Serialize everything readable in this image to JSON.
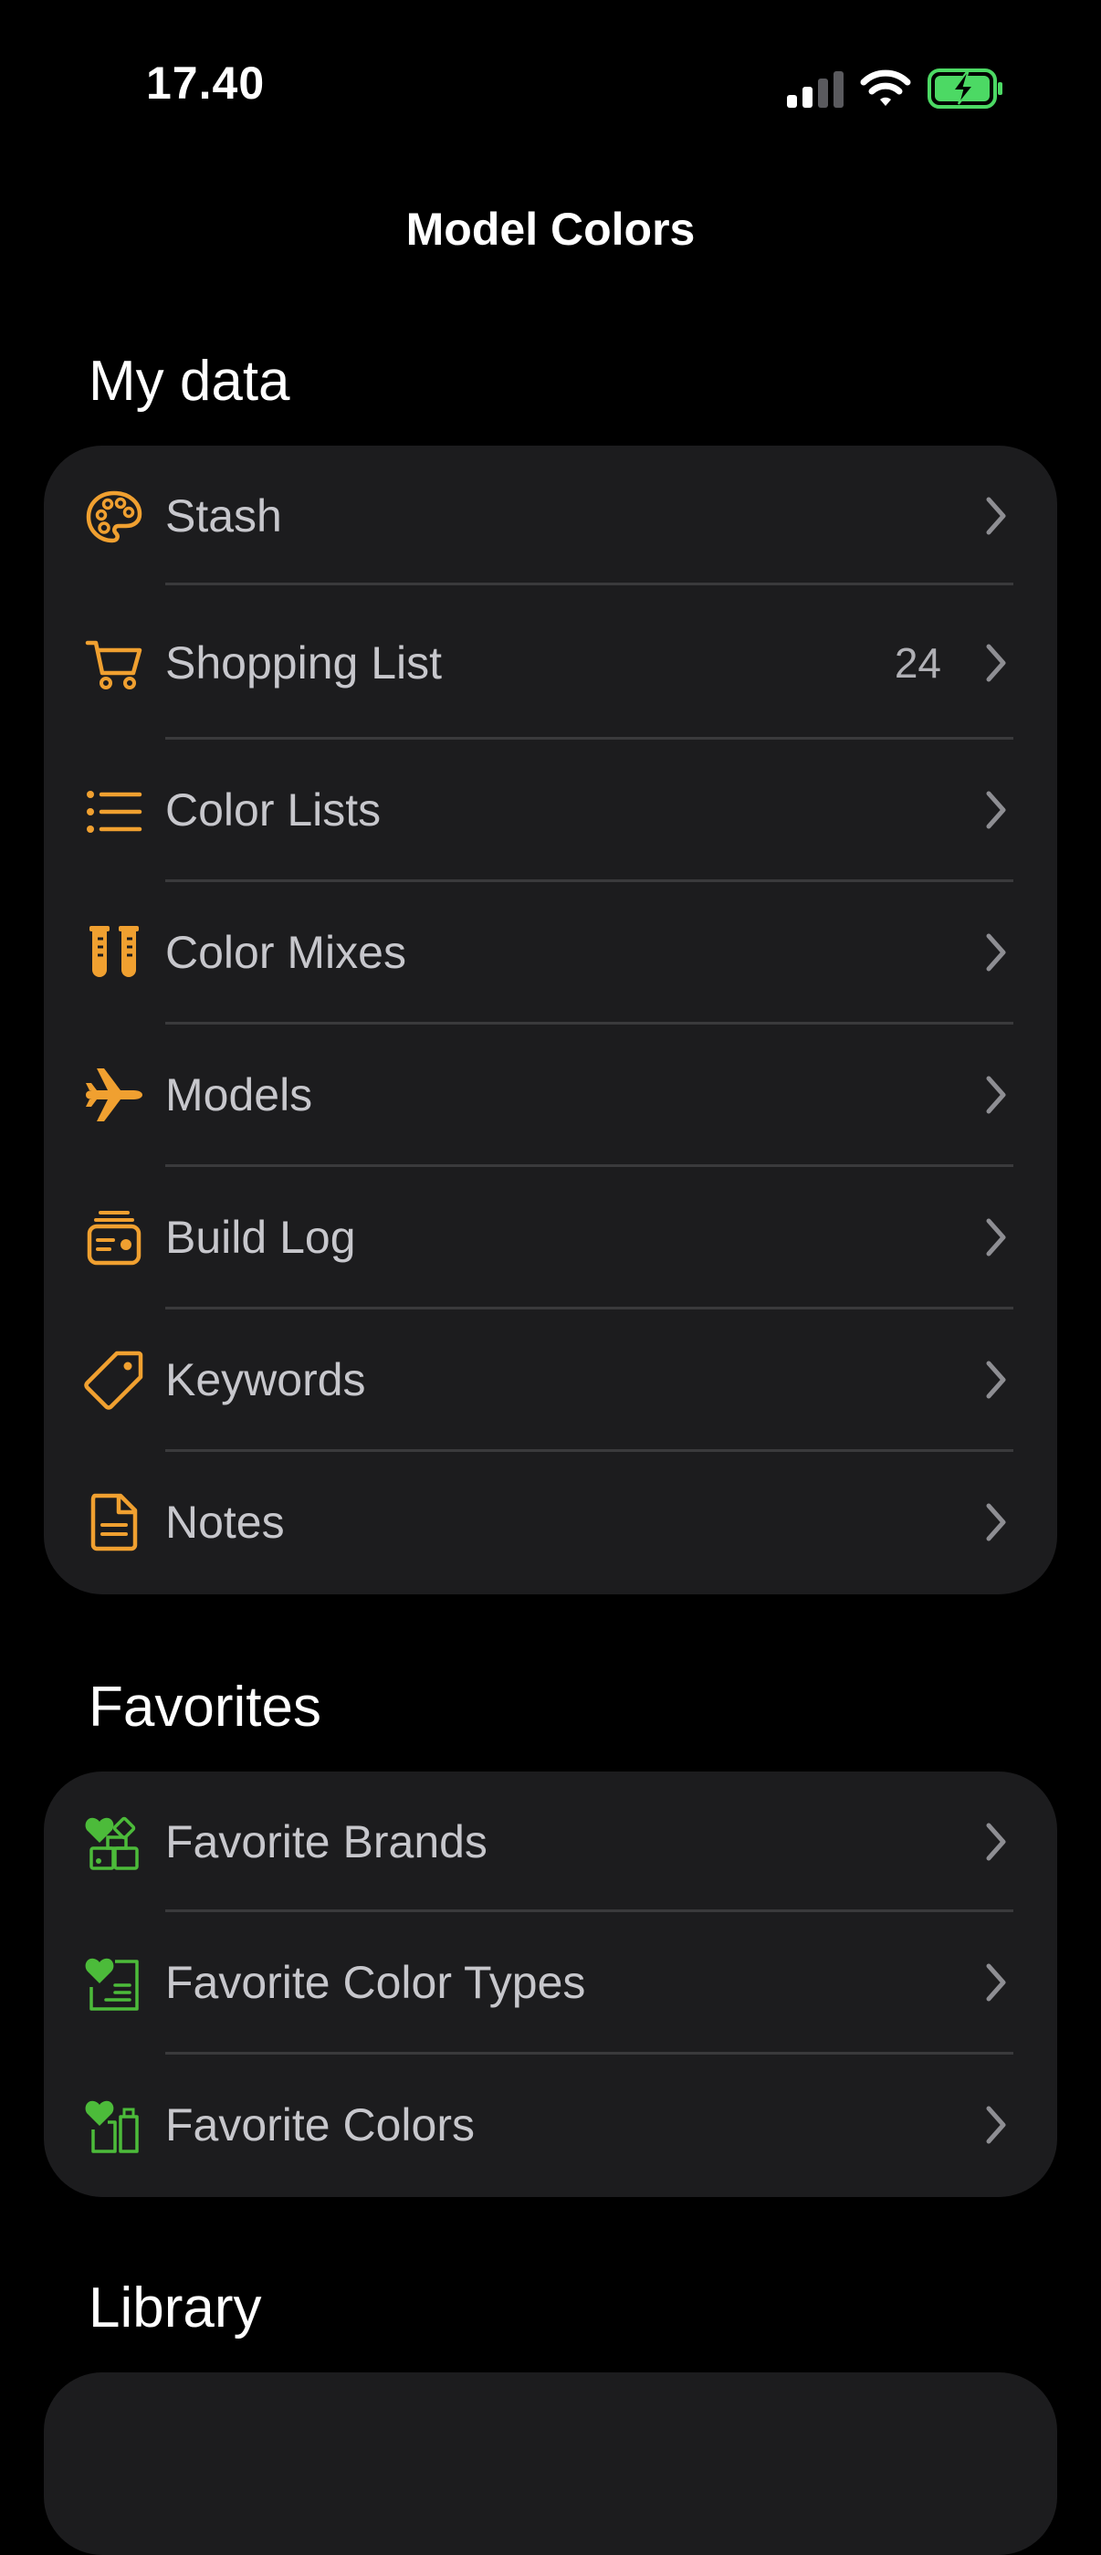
{
  "status_bar": {
    "time": "17.40",
    "signal_icon": "cellular-signal-icon",
    "wifi_icon": "wifi-icon",
    "battery_icon": "battery-charging-icon",
    "battery_color": "#4cd964"
  },
  "nav": {
    "title": "Model Colors"
  },
  "colors": {
    "accent_orange": "#f0a030",
    "accent_green": "#4cbb3a",
    "card_bg": "#1c1c1e",
    "row_text": "#c7c7cc",
    "chevron": "#8e8e93"
  },
  "sections": {
    "my_data": {
      "header": "My data",
      "items": [
        {
          "label": "Stash",
          "icon": "palette-icon",
          "count": ""
        },
        {
          "label": "Shopping List",
          "icon": "cart-icon",
          "count": "24"
        },
        {
          "label": "Color Lists",
          "icon": "list-icon",
          "count": ""
        },
        {
          "label": "Color Mixes",
          "icon": "test-tubes-icon",
          "count": ""
        },
        {
          "label": "Models",
          "icon": "airplane-icon",
          "count": ""
        },
        {
          "label": "Build Log",
          "icon": "log-stack-icon",
          "count": ""
        },
        {
          "label": "Keywords",
          "icon": "tag-icon",
          "count": ""
        },
        {
          "label": "Notes",
          "icon": "document-icon",
          "count": ""
        }
      ]
    },
    "favorites": {
      "header": "Favorites",
      "items": [
        {
          "label": "Favorite Brands",
          "icon": "heart-brands-icon"
        },
        {
          "label": "Favorite Color Types",
          "icon": "heart-types-icon"
        },
        {
          "label": "Favorite Colors",
          "icon": "heart-colors-icon"
        }
      ]
    },
    "library": {
      "header": "Library"
    }
  }
}
